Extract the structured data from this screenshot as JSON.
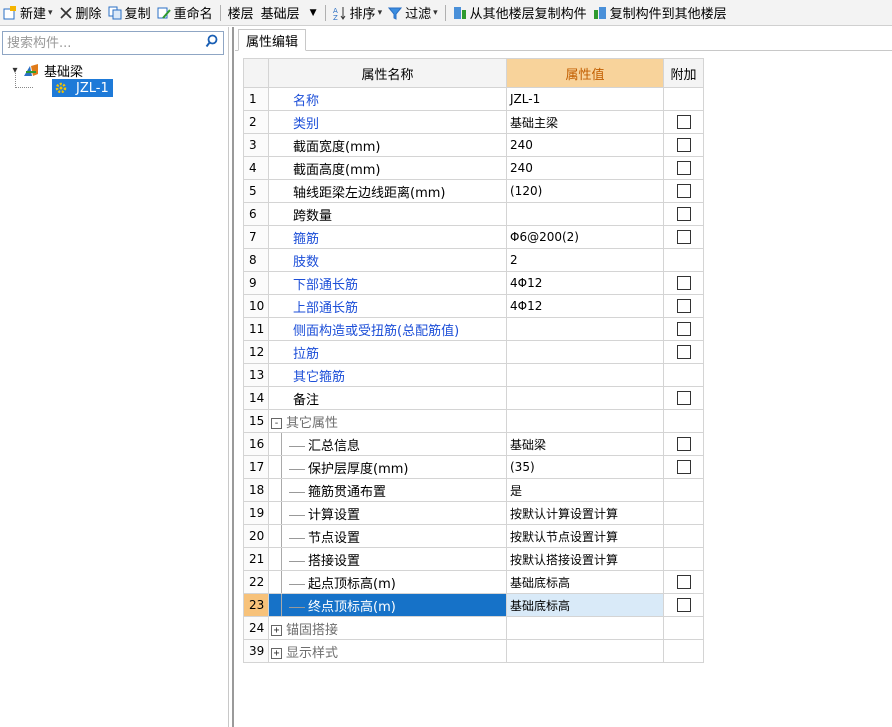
{
  "toolbar": {
    "new": "新建",
    "delete": "删除",
    "copy": "复制",
    "rename": "重命名",
    "floor_label": "楼层",
    "floor_value": "基础层",
    "sort": "排序",
    "filter": "过滤",
    "copy_from_floor": "从其他楼层复制构件",
    "copy_to_floor": "复制构件到其他楼层"
  },
  "search": {
    "placeholder": "搜索构件..."
  },
  "tree": {
    "root": "基础梁",
    "child": "JZL-1"
  },
  "tab": {
    "label": "属性编辑"
  },
  "table": {
    "headers": {
      "name": "属性名称",
      "value": "属性值",
      "extra": "附加"
    },
    "rows": [
      {
        "num": "1",
        "name": "名称",
        "value": "JZL-1",
        "blue": true,
        "checkbox": false
      },
      {
        "num": "2",
        "name": "类别",
        "value": "基础主梁",
        "blue": true,
        "checkbox": true
      },
      {
        "num": "3",
        "name": "截面宽度(mm)",
        "value": "240",
        "blue": false,
        "checkbox": true
      },
      {
        "num": "4",
        "name": "截面高度(mm)",
        "value": "240",
        "blue": false,
        "checkbox": true
      },
      {
        "num": "5",
        "name": "轴线距梁左边线距离(mm)",
        "value": "(120)",
        "blue": false,
        "checkbox": true
      },
      {
        "num": "6",
        "name": "跨数量",
        "value": "",
        "blue": false,
        "checkbox": true
      },
      {
        "num": "7",
        "name": "箍筋",
        "value": "Φ6@200(2)",
        "blue": true,
        "checkbox": true
      },
      {
        "num": "8",
        "name": "肢数",
        "value": "2",
        "blue": true,
        "checkbox": false
      },
      {
        "num": "9",
        "name": "下部通长筋",
        "value": "4Φ12",
        "blue": true,
        "checkbox": true
      },
      {
        "num": "10",
        "name": "上部通长筋",
        "value": "4Φ12",
        "blue": true,
        "checkbox": true
      },
      {
        "num": "11",
        "name": "侧面构造或受扭筋(总配筋值)",
        "value": "",
        "blue": true,
        "checkbox": true
      },
      {
        "num": "12",
        "name": "拉筋",
        "value": "",
        "blue": true,
        "checkbox": true
      },
      {
        "num": "13",
        "name": "其它箍筋",
        "value": "",
        "blue": true,
        "checkbox": false
      },
      {
        "num": "14",
        "name": "备注",
        "value": "",
        "blue": false,
        "checkbox": true
      },
      {
        "num": "15",
        "name": "其它属性",
        "value": "",
        "group": "-",
        "checkbox": false
      },
      {
        "num": "16",
        "name": "汇总信息",
        "value": "基础梁",
        "child": true,
        "checkbox": true
      },
      {
        "num": "17",
        "name": "保护层厚度(mm)",
        "value": "(35)",
        "child": true,
        "checkbox": true
      },
      {
        "num": "18",
        "name": "箍筋贯通布置",
        "value": "是",
        "child": true,
        "checkbox": false
      },
      {
        "num": "19",
        "name": "计算设置",
        "value": "按默认计算设置计算",
        "child": true,
        "checkbox": false
      },
      {
        "num": "20",
        "name": "节点设置",
        "value": "按默认节点设置计算",
        "child": true,
        "checkbox": false
      },
      {
        "num": "21",
        "name": "搭接设置",
        "value": "按默认搭接设置计算",
        "child": true,
        "checkbox": false
      },
      {
        "num": "22",
        "name": "起点顶标高(m)",
        "value": "基础底标高",
        "child": true,
        "checkbox": true
      },
      {
        "num": "23",
        "name": "终点顶标高(m)",
        "value": "基础底标高",
        "child": true,
        "checkbox": true,
        "selected": true
      },
      {
        "num": "24",
        "name": "锚固搭接",
        "value": "",
        "group": "+",
        "checkbox": false
      },
      {
        "num": "39",
        "name": "显示样式",
        "value": "",
        "group": "+",
        "checkbox": false
      }
    ]
  },
  "colors": {
    "selection": "#1672c8",
    "header_value": "#f8d39b",
    "blue_text": "#1d4fd8"
  }
}
